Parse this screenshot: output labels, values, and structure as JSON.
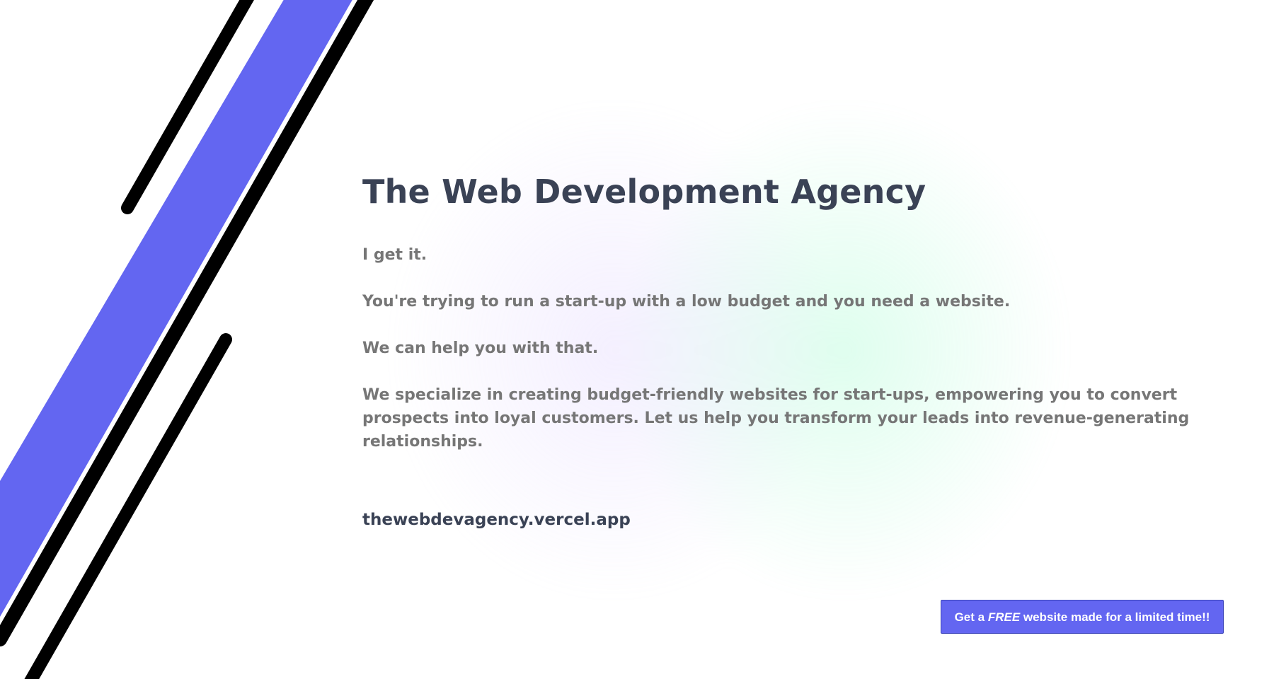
{
  "hero": {
    "title": "The Web Development Agency",
    "paragraphs": [
      "I get it.",
      "You're trying to run a start-up with a low budget and you need a website.",
      "We can help you with that.",
      "We specialize in creating budget-friendly websites for start-ups, empowering you to convert prospects into loyal customers. Let us help you transform your leads into revenue-generating relationships."
    ],
    "website": "thewebdevagency.vercel.app"
  },
  "cta": {
    "prefix": "Get a ",
    "emphasis": "FREE",
    "suffix": " website made for a limited time!!"
  },
  "colors": {
    "accent": "#6366f1",
    "title": "#3a4255",
    "body_text": "#767676",
    "stripe": "#000000"
  }
}
